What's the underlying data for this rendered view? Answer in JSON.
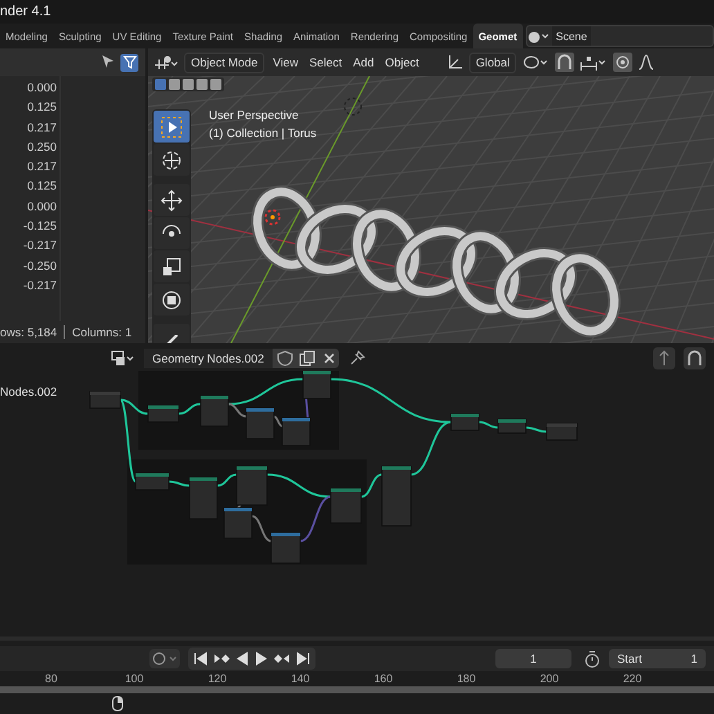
{
  "window": {
    "title": "nder 4.1"
  },
  "workspace_tabs": [
    {
      "label": "Modeling",
      "selected": false
    },
    {
      "label": "Sculpting",
      "selected": false
    },
    {
      "label": "UV Editing",
      "selected": false
    },
    {
      "label": "Texture Paint",
      "selected": false
    },
    {
      "label": "Shading",
      "selected": false
    },
    {
      "label": "Animation",
      "selected": false
    },
    {
      "label": "Rendering",
      "selected": false
    },
    {
      "label": "Compositing",
      "selected": false
    },
    {
      "label": "Geomet",
      "selected": true
    }
  ],
  "scene": {
    "label": "Scene"
  },
  "spreadsheet": {
    "values": [
      "0.000",
      "0.125",
      "0.217",
      "0.250",
      "0.217",
      "0.125",
      "0.000",
      "-0.125",
      "-0.217",
      "-0.250",
      "-0.217"
    ],
    "rows": "ows: 5,184",
    "columns": "Columns: 1",
    "filter_on": true
  },
  "viewport": {
    "mode": "Object Mode",
    "menus": [
      "View",
      "Select",
      "Add",
      "Object"
    ],
    "orientation": "Global",
    "overlay_lines": [
      "User Perspective",
      "(1) Collection | Torus"
    ],
    "tools": [
      {
        "kind": "select",
        "selected": true
      },
      {
        "kind": "cursor",
        "selected": false
      },
      {
        "kind": "move",
        "selected": false
      },
      {
        "kind": "rotate",
        "selected": false
      },
      {
        "kind": "scale",
        "selected": false
      },
      {
        "kind": "transform",
        "selected": false
      },
      {
        "kind": "annotate",
        "selected": false
      }
    ]
  },
  "node_editor": {
    "tree_name": "Geometry Nodes.002",
    "breadcrumb": "Nodes.002"
  },
  "timeline": {
    "current_frame": "1",
    "start_label": "Start",
    "start_value": "1",
    "ruler": [
      "80",
      "100",
      "120",
      "140",
      "160",
      "180",
      "200",
      "220"
    ]
  }
}
